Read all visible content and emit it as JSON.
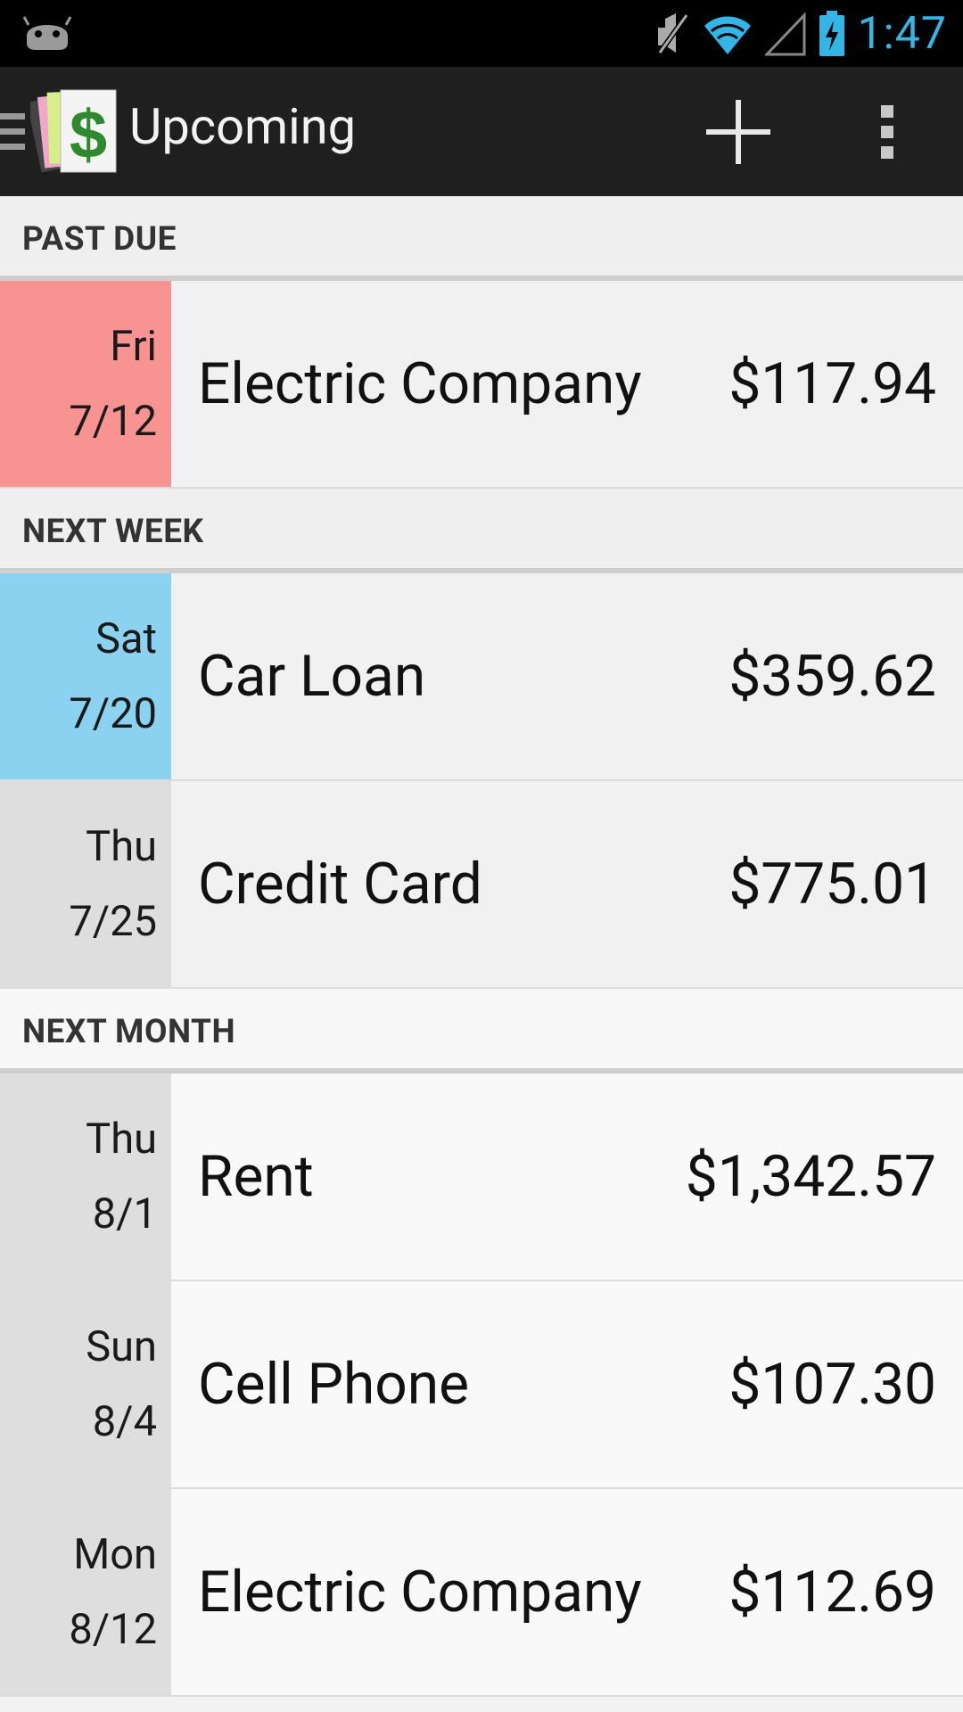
{
  "status_bar": {
    "time": "1:47",
    "icons": [
      "android-icon",
      "mute-icon",
      "wifi-icon",
      "signal-icon",
      "battery-charging-icon"
    ]
  },
  "action_bar": {
    "title": "Upcoming",
    "icons": [
      "drawer-icon",
      "app-logo-icon",
      "add-icon",
      "overflow-menu-icon"
    ]
  },
  "sections": [
    {
      "header": "PAST DUE",
      "bills": [
        {
          "day": "Fri",
          "date": "7/12",
          "name": "Electric Company",
          "amount": "$117.94"
        }
      ]
    },
    {
      "header": "NEXT WEEK",
      "bills": [
        {
          "day": "Sat",
          "date": "7/20",
          "name": "Car Loan",
          "amount": "$359.62"
        },
        {
          "day": "Thu",
          "date": "7/25",
          "name": "Credit Card",
          "amount": "$775.01"
        }
      ]
    },
    {
      "header": "NEXT MONTH",
      "bills": [
        {
          "day": "Thu",
          "date": "8/1",
          "name": "Rent",
          "amount": "$1,342.57"
        },
        {
          "day": "Sun",
          "date": "8/4",
          "name": "Cell Phone",
          "amount": "$107.30"
        },
        {
          "day": "Mon",
          "date": "8/12",
          "name": "Electric Company",
          "amount": "$112.69"
        }
      ]
    }
  ],
  "colors": {
    "past_due": "#f79492",
    "next_week": "#8ad2ef",
    "default_date": "#dedede",
    "accent": "#33b5e5"
  }
}
